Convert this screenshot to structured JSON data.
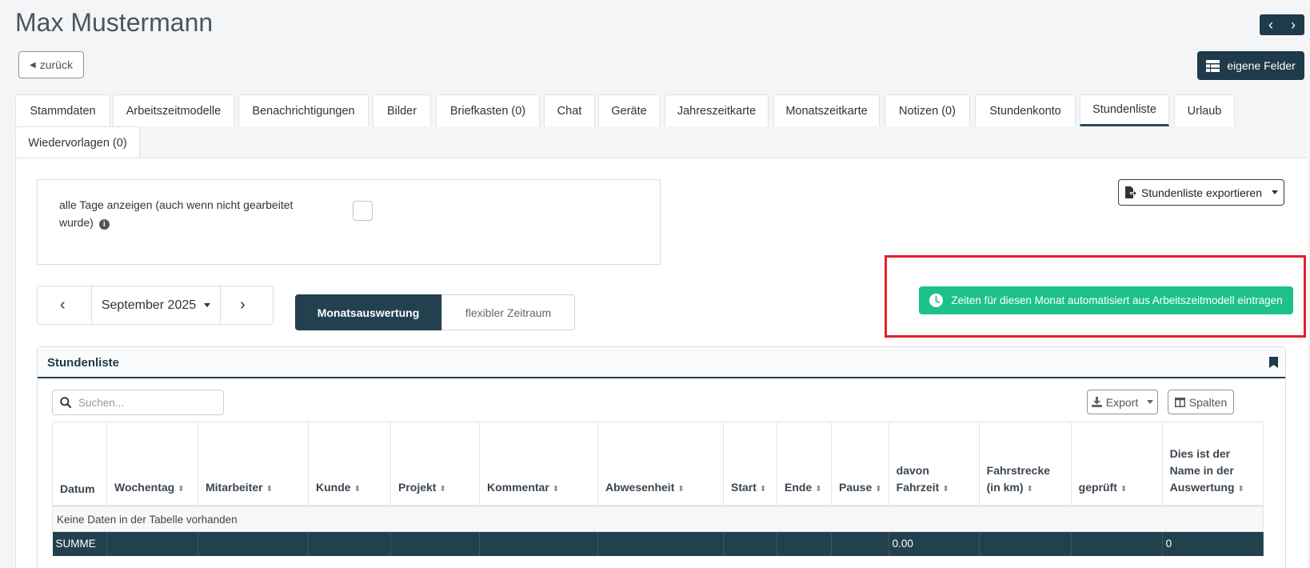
{
  "header": {
    "title": "Max Mustermann",
    "back_label": "zurück",
    "own_fields_label": "eigene Felder"
  },
  "tabs": [
    {
      "label": "Stammdaten"
    },
    {
      "label": "Arbeitszeitmodelle"
    },
    {
      "label": "Benachrichtigungen"
    },
    {
      "label": "Bilder"
    },
    {
      "label": "Briefkasten (0)"
    },
    {
      "label": "Chat"
    },
    {
      "label": "Geräte"
    },
    {
      "label": "Jahreszeitkarte"
    },
    {
      "label": "Monatszeitkarte"
    },
    {
      "label": "Notizen (0)"
    },
    {
      "label": "Stundenkonto"
    },
    {
      "label": "Stundenliste",
      "active": true
    },
    {
      "label": "Urlaub"
    },
    {
      "label": "Wiedervorlagen (0)"
    }
  ],
  "options": {
    "show_all_days_label": "alle Tage anzeigen (auch wenn nicht gearbeitet wurde)",
    "show_all_days_checked": false
  },
  "export_list_label": "Stundenliste exportieren",
  "period": {
    "month": "September 2025",
    "mode_month": "Monatsauswertung",
    "mode_flexible": "flexibler Zeitraum"
  },
  "auto_fill_label": "Zeiten für diesen Monat automatisiert aus Arbeitszeitmodell eintragen",
  "card": {
    "title": "Stundenliste",
    "search_placeholder": "Suchen...",
    "export_label": "Export",
    "columns_label": "Spalten"
  },
  "table": {
    "headers": [
      "Datum",
      "Wochentag",
      "Mitarbeiter",
      "Kunde",
      "Projekt",
      "Kommentar",
      "Abwesenheit",
      "Start",
      "Ende",
      "Pause",
      "davon Fahrzeit",
      "Fahrstrecke (in km)",
      "geprüft",
      "Dies ist der Name in der Auswertung"
    ],
    "empty_message": "Keine Daten in der Tabelle vorhanden",
    "sum_row": [
      "SUMME",
      "",
      "",
      "",
      "",
      "",
      "",
      "",
      "",
      "",
      "0.00",
      "",
      "",
      "0"
    ]
  },
  "colors": {
    "primary": "#23404f",
    "success": "#1fc18b",
    "highlight": "#e0202b"
  }
}
